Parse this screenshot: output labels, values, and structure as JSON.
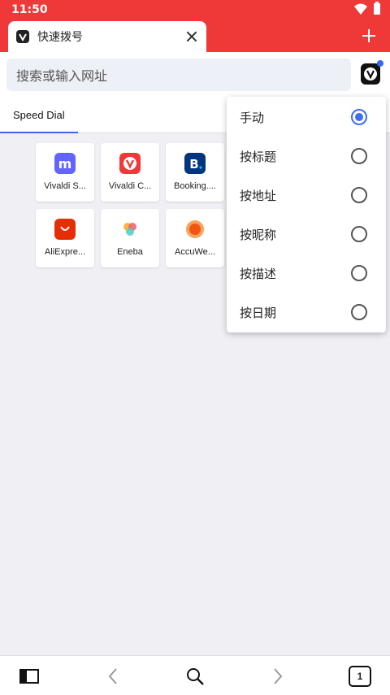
{
  "status": {
    "time": "11:50"
  },
  "tab": {
    "title": "快速拨号",
    "favicon": "vivaldi-logo-icon"
  },
  "address": {
    "placeholder": "搜索或输入网址"
  },
  "speed_dial": {
    "tab_label": "Speed Dial",
    "tiles": [
      {
        "label": "Vivaldi S...",
        "icon": "mastodon-icon",
        "color": "#6364ff"
      },
      {
        "label": "Vivaldi C...",
        "icon": "vivaldi-icon",
        "color": "#ef3939"
      },
      {
        "label": "Booking....",
        "icon": "booking-icon",
        "color": "#003580"
      },
      {
        "label": "AliExpre...",
        "icon": "aliexpress-icon",
        "color": "#e62e04"
      },
      {
        "label": "Eneba",
        "icon": "eneba-icon",
        "color": "#f45b69"
      },
      {
        "label": "AccuWe...",
        "icon": "accuweather-icon",
        "color": "#f05514"
      }
    ]
  },
  "sort_menu": {
    "items": [
      {
        "label": "手动",
        "selected": true
      },
      {
        "label": "按标题",
        "selected": false
      },
      {
        "label": "按地址",
        "selected": false
      },
      {
        "label": "按昵称",
        "selected": false
      },
      {
        "label": "按描述",
        "selected": false
      },
      {
        "label": "按日期",
        "selected": false
      }
    ]
  },
  "bottom": {
    "tab_count": "1"
  },
  "colors": {
    "brand_red": "#ef3939",
    "accent_blue": "#3b6ef0"
  }
}
